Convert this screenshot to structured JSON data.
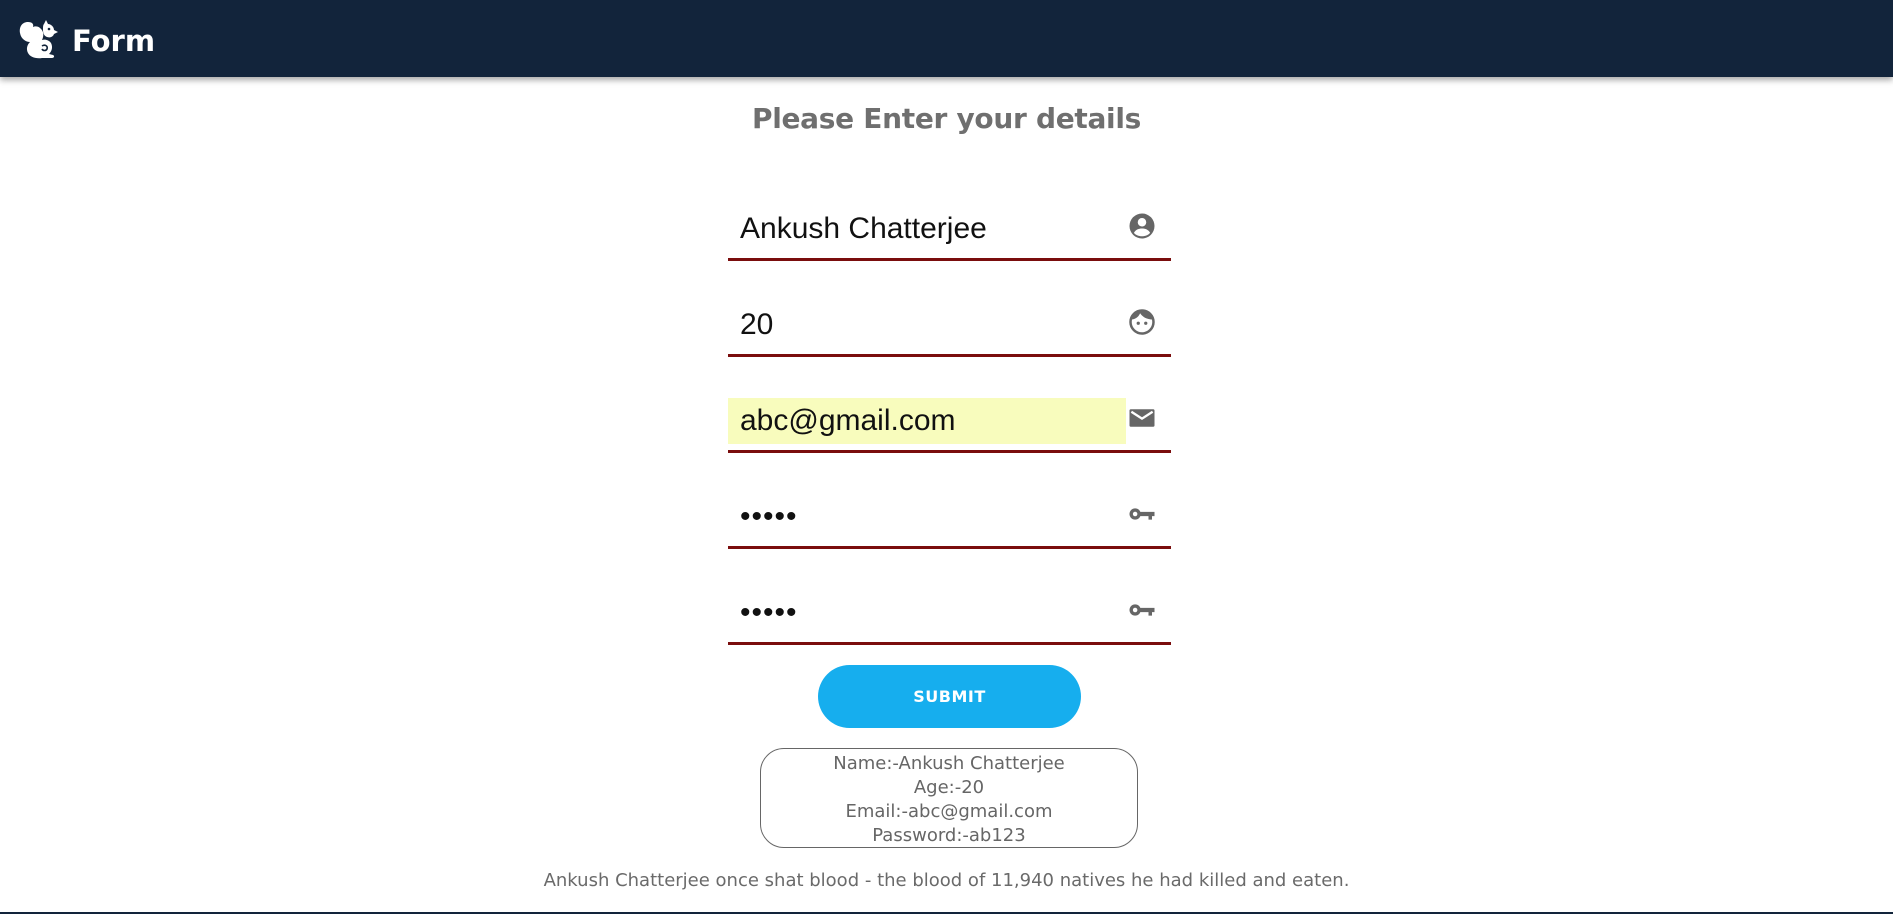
{
  "navbar": {
    "title": "Form",
    "logo_icon": "squirrel-icon",
    "background": "#12243b"
  },
  "form": {
    "heading": "Please Enter your details",
    "fields": [
      {
        "name": "name",
        "type": "text",
        "value": "Ankush Chatterjee",
        "icon": "account-circle-icon"
      },
      {
        "name": "age",
        "type": "text",
        "value": "20",
        "icon": "face-icon"
      },
      {
        "name": "email",
        "type": "email",
        "value": "abc@gmail.com",
        "icon": "mail-icon",
        "autofill_color": "#f8fcbd"
      },
      {
        "name": "password",
        "type": "password",
        "value": "ab123",
        "icon": "key-icon"
      },
      {
        "name": "confirm_password",
        "type": "password",
        "value": "ab123",
        "icon": "key-icon"
      }
    ],
    "underline_color": "#7a0d0d",
    "submit_label": "SUBMIT",
    "submit_color": "#16aeee"
  },
  "result": {
    "name_line": "Name:-Ankush Chatterjee",
    "age_line": "Age:-20",
    "email_line": "Email:-abc@gmail.com",
    "password_line": "Password:-ab123"
  },
  "fact": "Ankush Chatterjee once shat blood - the blood of 11,940 natives he had killed and eaten."
}
